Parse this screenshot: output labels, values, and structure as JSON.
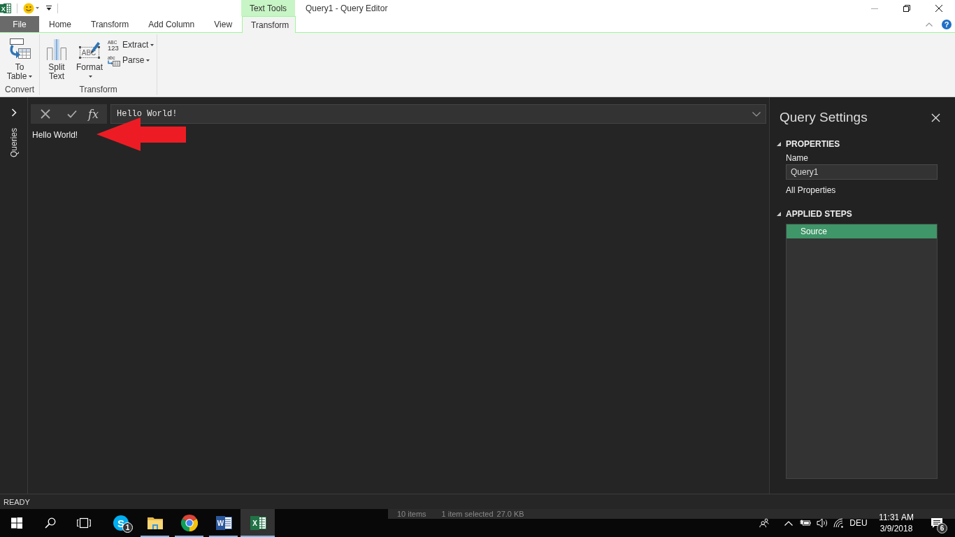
{
  "title_bar": {
    "logo_glyph": "X",
    "context_label": "Text Tools",
    "title": "Query1 - Query Editor"
  },
  "ribbon": {
    "tabs": [
      {
        "label": "File",
        "kind": "file",
        "selected": false
      },
      {
        "label": "Home",
        "kind": "tab",
        "selected": false
      },
      {
        "label": "Transform",
        "kind": "tab",
        "selected": false
      },
      {
        "label": "Add Column",
        "kind": "tab",
        "selected": false
      },
      {
        "label": "View",
        "kind": "tab",
        "selected": false
      },
      {
        "label": "Transform",
        "kind": "tab",
        "selected": true
      }
    ],
    "help_glyph": "?",
    "groups": [
      {
        "label": "Convert",
        "buttons": [
          {
            "label": "To Table",
            "kind": "table",
            "dropdown": true
          }
        ]
      },
      {
        "label": "Transform",
        "buttons": [
          {
            "label": "Split Text",
            "kind": "split",
            "dropdown": false
          },
          {
            "label": "Format",
            "kind": "format",
            "icon_text": [
              "ABC"
            ],
            "dropdown": true
          },
          {
            "label": "Extract",
            "kind": "extract",
            "icon_text": [
              "ABC",
              "123"
            ],
            "dropdown": true
          },
          {
            "label": "Parse",
            "kind": "parse",
            "icon_text": [
              "abc"
            ],
            "dropdown": true
          }
        ]
      }
    ]
  },
  "queries_pane": {
    "label": "Queries",
    "expanded": false
  },
  "formula_bar": {
    "function_label": "fx",
    "value": "Hello World!"
  },
  "preview": {
    "value": "Hello World!"
  },
  "query_settings": {
    "title": "Query Settings",
    "properties": {
      "heading": "PROPERTIES",
      "expanded": true,
      "name_label": "Name",
      "name_value": "Query1",
      "link": "All Properties"
    },
    "applied_steps": {
      "heading": "APPLIED STEPS",
      "expanded": true,
      "steps": [
        {
          "label": "Source",
          "selected": true
        }
      ]
    }
  },
  "status_bar": {
    "text": "READY"
  },
  "background_window": {
    "item_count": "10 items",
    "selection": "1 item selected",
    "size": "27.0 KB"
  },
  "taskbar": {
    "apps": [
      {
        "kind": "chat",
        "glyph": "S",
        "badge": "1",
        "running": false,
        "selected": false
      },
      {
        "kind": "folder",
        "running": true,
        "selected": false
      },
      {
        "kind": "browser",
        "running": true,
        "selected": false
      },
      {
        "kind": "word",
        "glyph": "W",
        "running": true,
        "selected": false
      },
      {
        "kind": "sheet",
        "glyph": "X",
        "running": true,
        "selected": true
      }
    ],
    "language": "DEU",
    "time": "11:31 AM",
    "date": "3/9/2018",
    "notification_count": "6"
  }
}
